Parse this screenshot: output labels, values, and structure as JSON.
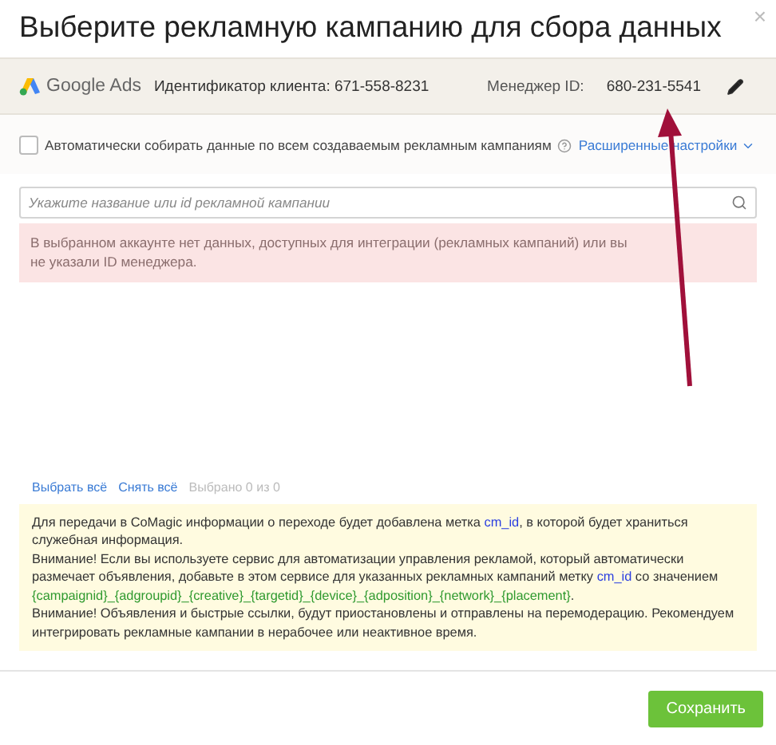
{
  "dialog": {
    "title": "Выберите рекламную кампанию для сбора данных",
    "close": "×"
  },
  "account": {
    "brand": "Google Ads",
    "client_id": "Идентификатор клиента: 671-558-8231",
    "manager_label": "Менеджер ID:",
    "manager_id": "680-231-5541"
  },
  "auto_collect": {
    "label": "Автоматически собирать данные по всем создаваемым рекламным кампаниям",
    "checked": false,
    "advanced": "Расширенные настройки"
  },
  "search": {
    "placeholder": "Укажите название или id рекламной кампании"
  },
  "error": "В выбранном аккаунте нет данных, доступных для интеграции (рекламных кампаний) или вы не указали ID менеджера.",
  "selection": {
    "select_all": "Выбрать всё",
    "deselect_all": "Снять всё",
    "count": "Выбрано 0 из 0"
  },
  "notice": [
    [
      {
        "kind": "text",
        "text": "Для передачи в CoMagic информации о переходе будет добавлена метка "
      },
      {
        "kind": "code",
        "text": "cm_id"
      },
      {
        "kind": "text",
        "text": ", в которой будет храниться служебная информация."
      }
    ],
    [
      {
        "kind": "text",
        "text": "Внимание! Если вы используете сервис для автоматизации управления рекламой, который автоматически размечает объявления, добавьте в этом сервисе для указанных рекламных кампаний метку "
      },
      {
        "kind": "code",
        "text": "cm_id"
      },
      {
        "kind": "text",
        "text": " со значением "
      },
      {
        "kind": "value",
        "text": "{campaignid}_{adgroupid}_{creative}_{targetid}_{device}_{adposition}_{network}_{placement}"
      },
      {
        "kind": "text",
        "text": "."
      }
    ],
    [
      {
        "kind": "text",
        "text": "Внимание! Объявления и быстрые ссылки, будут приостановлены и отправлены на перемодерацию. Рекомендуем интегрировать рекламные кампании в нерабочее или неактивное время."
      }
    ]
  ],
  "buttons": {
    "save": "Сохранить"
  }
}
